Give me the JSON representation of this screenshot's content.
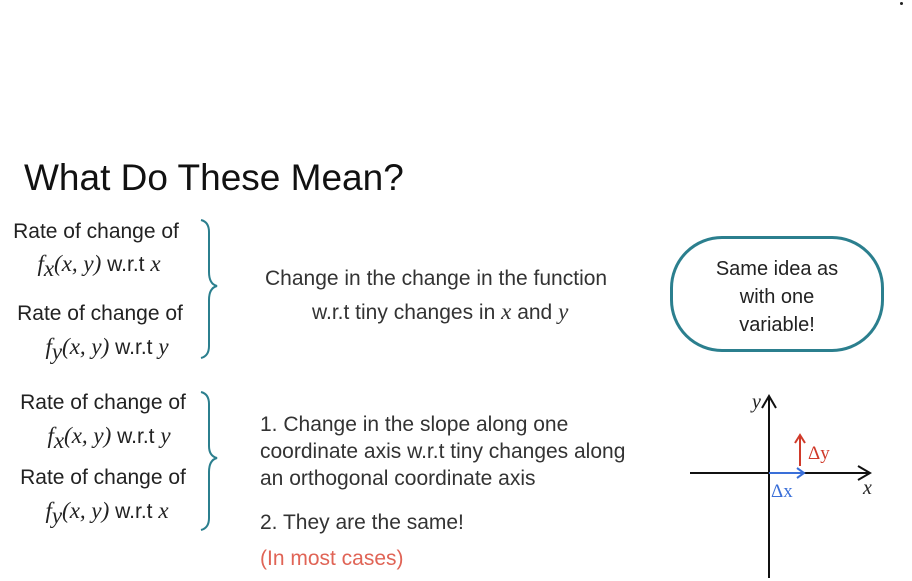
{
  "slide": {
    "title": "What Do These Mean?",
    "top_block": {
      "row1_line1": "Rate of change of",
      "row1_func": "f",
      "row1_sub": "x",
      "row1_args": "(x, y)",
      "row1_wrt": "w.r.t",
      "row1_var": "x",
      "row2_line1": "Rate of change of",
      "row2_func": "f",
      "row2_sub": "y",
      "row2_args": "(x, y)",
      "row2_wrt": "w.r.t",
      "row2_var": "y",
      "explanation_line1": "Change in the change in the function",
      "explanation_line2_pre": "w.r.t tiny changes in",
      "explanation_var_x": "x",
      "explanation_and": "and",
      "explanation_var_y": "y"
    },
    "bubble": {
      "line1": "Same idea as",
      "line2": "with one",
      "line3": "variable!",
      "border_color": "#2b7f8e"
    },
    "bottom_block": {
      "row1_line1": "Rate of change of",
      "row1_func": "f",
      "row1_sub": "x",
      "row1_args": "(x, y)",
      "row1_wrt": "w.r.t",
      "row1_var": "y",
      "row2_line1": "Rate of change of",
      "row2_func": "f",
      "row2_sub": "y",
      "row2_args": "(x, y)",
      "row2_wrt": "w.r.t",
      "row2_var": "x",
      "point1_line1": "1. Change in the slope along one",
      "point1_line2": "coordinate axis w.r.t tiny changes along",
      "point1_line3": "an orthogonal coordinate axis",
      "point2": "2. They are the same!",
      "note": "(In most cases)",
      "note_color": "#e06456"
    },
    "axes": {
      "x_label": "x",
      "y_label": "y",
      "dx_label": "Δx",
      "dy_label": "Δy",
      "dx_color": "#3a6fd8",
      "dy_color": "#d03a2a"
    }
  }
}
